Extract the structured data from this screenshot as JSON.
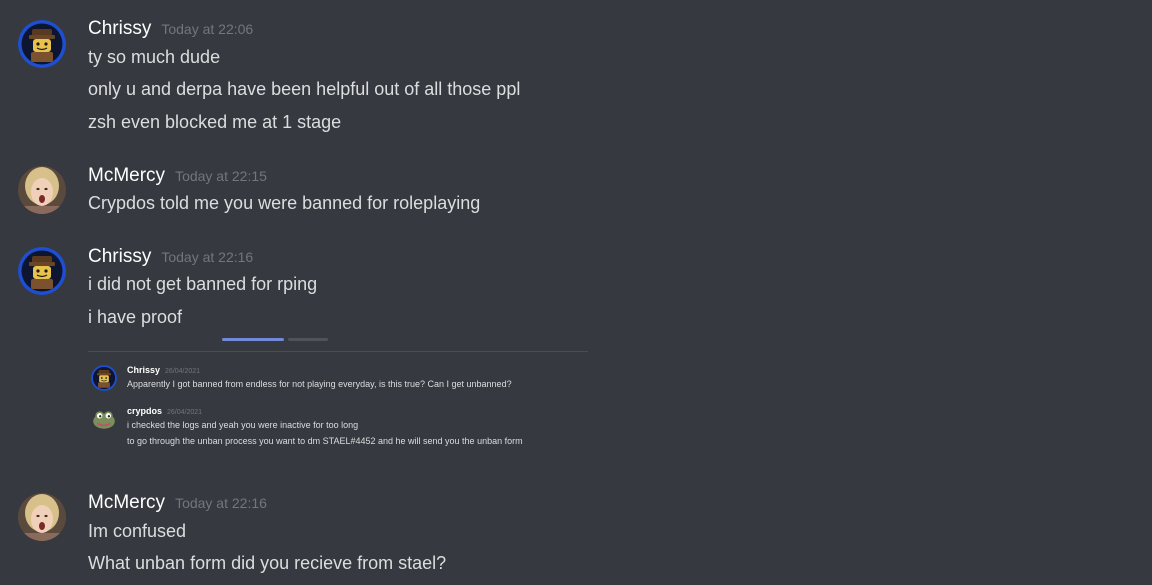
{
  "messages": [
    {
      "author": "Chrissy",
      "timestamp": "Today at 22:06",
      "avatar": "lego-figure-avatar",
      "lines": [
        "ty so much dude",
        "only u and derpa have been helpful out of all those ppl",
        "zsh even blocked me at 1 stage"
      ]
    },
    {
      "author": "McMercy",
      "timestamp": "Today at 22:15",
      "avatar": "surprised-woman-avatar",
      "lines": [
        "Crypdos told me you were banned for roleplaying"
      ]
    },
    {
      "author": "Chrissy",
      "timestamp": "Today at 22:16",
      "avatar": "lego-figure-avatar",
      "lines": [
        "i did not get banned for rping",
        "i have proof"
      ]
    },
    {
      "author": "McMercy",
      "timestamp": "Today at 22:16",
      "avatar": "surprised-woman-avatar",
      "lines": [
        "Im confused",
        "What unban form did you recieve from stael?"
      ]
    }
  ],
  "embedded_screenshot": {
    "messages": [
      {
        "author": "Chrissy",
        "timestamp": "26/04/2021",
        "avatar": "lego-figure-avatar",
        "lines": [
          "Apparently I got banned from endless for not playing everyday, is this true?  Can I get unbanned?"
        ]
      },
      {
        "author": "crypdos",
        "timestamp": "26/04/2021",
        "avatar": "frog-avatar",
        "lines": [
          "i checked the logs and yeah you were inactive for too long",
          "to go through the unban process you want to dm STAEL#4452 and he will send you the unban form"
        ]
      }
    ]
  },
  "colors": {
    "background": "#36393f",
    "author": "#ffffff",
    "text": "#dcddde",
    "timestamp": "#72767d",
    "accent": "#7289da"
  }
}
